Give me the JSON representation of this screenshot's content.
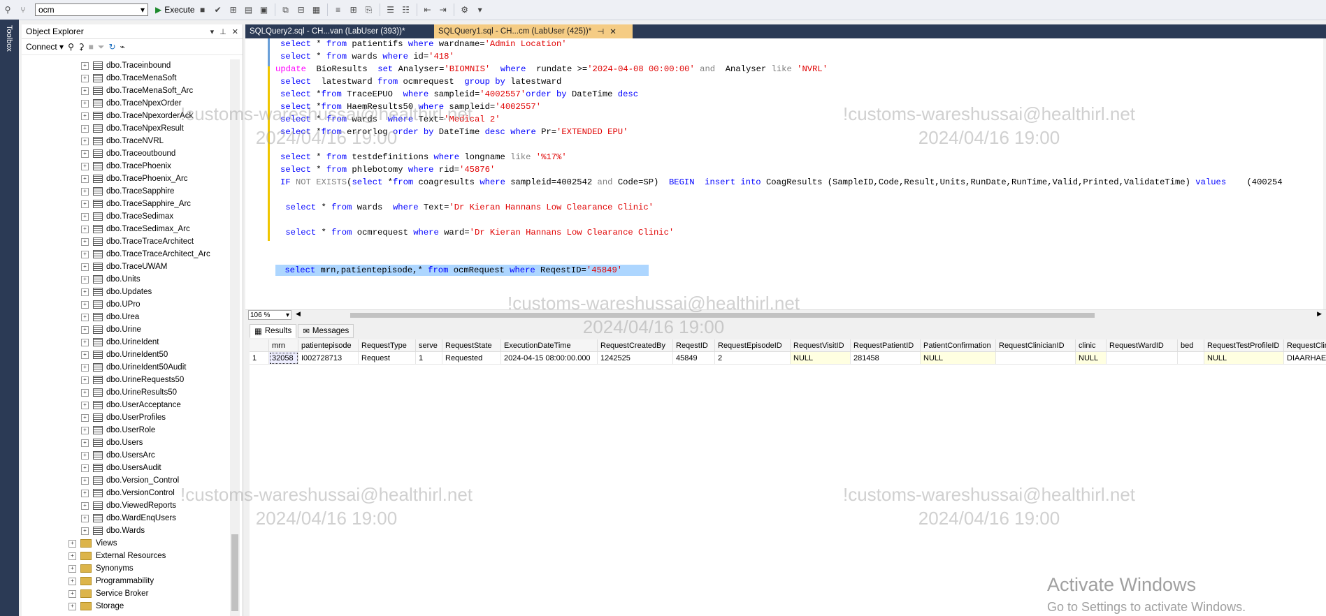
{
  "toolbar": {
    "database": "ocm",
    "execute_label": "Execute"
  },
  "toolbox": {
    "label": "Toolbox"
  },
  "object_explorer": {
    "title": "Object Explorer",
    "connect_label": "Connect",
    "tables": [
      "dbo.Traceinbound",
      "dbo.TraceMenaSoft",
      "dbo.TraceMenaSoft_Arc",
      "dbo.TraceNpexOrder",
      "dbo.TraceNpexorderAck",
      "dbo.TraceNpexResult",
      "dbo.TraceNVRL",
      "dbo.Traceoutbound",
      "dbo.TracePhoenix",
      "dbo.TracePhoenix_Arc",
      "dbo.TraceSapphire",
      "dbo.TraceSapphire_Arc",
      "dbo.TraceSedimax",
      "dbo.TraceSedimax_Arc",
      "dbo.TraceTraceArchitect",
      "dbo.TraceTraceArchitect_Arc",
      "dbo.TraceUWAM",
      "dbo.Units",
      "dbo.Updates",
      "dbo.UPro",
      "dbo.Urea",
      "dbo.Urine",
      "dbo.UrineIdent",
      "dbo.UrineIdent50",
      "dbo.UrineIdent50Audit",
      "dbo.UrineRequests50",
      "dbo.UrineResults50",
      "dbo.UserAcceptance",
      "dbo.UserProfiles",
      "dbo.UserRole",
      "dbo.Users",
      "dbo.UsersArc",
      "dbo.UsersAudit",
      "dbo.Version_Control",
      "dbo.VersionControl",
      "dbo.ViewedReports",
      "dbo.WardEnqUsers",
      "dbo.Wards"
    ],
    "folders": [
      "Views",
      "External Resources",
      "Synonyms",
      "Programmability",
      "Service Broker",
      "Storage"
    ]
  },
  "tabs": [
    {
      "label": "SQLQuery2.sql - CH...van (LabUser (393))*"
    },
    {
      "label": "SQLQuery1.sql - CH...cm (LabUser (425))*"
    }
  ],
  "editor": {
    "zoom": "106 %",
    "lines": [
      [
        [
          "select",
          "kw"
        ],
        [
          " * ",
          ""
        ],
        [
          "from",
          "kw"
        ],
        [
          " patientifs ",
          ""
        ],
        [
          "where",
          "kw"
        ],
        [
          " wardname=",
          ""
        ],
        [
          "'Admin Location'",
          "str"
        ]
      ],
      [
        [
          "select",
          "kw"
        ],
        [
          " * ",
          ""
        ],
        [
          "from",
          "kw"
        ],
        [
          " wards ",
          ""
        ],
        [
          "where",
          "kw"
        ],
        [
          " id=",
          ""
        ],
        [
          "'418'",
          "str"
        ]
      ],
      [
        [
          "update",
          "pink"
        ],
        [
          "  BioResults  ",
          ""
        ],
        [
          "set",
          "kw"
        ],
        [
          " Analyser=",
          ""
        ],
        [
          "'BIOMNIS'",
          "str"
        ],
        [
          "  ",
          ""
        ],
        [
          "where",
          "kw"
        ],
        [
          "  rundate >=",
          ""
        ],
        [
          "'2024-04-08 00:00:00'",
          "str"
        ],
        [
          " ",
          ""
        ],
        [
          "and",
          "gray"
        ],
        [
          "  Analyser ",
          ""
        ],
        [
          "like",
          "gray"
        ],
        [
          " ",
          ""
        ],
        [
          "'NVRL'",
          "str"
        ]
      ],
      [
        [
          "select",
          "kw"
        ],
        [
          "  latestward ",
          ""
        ],
        [
          "from",
          "kw"
        ],
        [
          " ocmrequest  ",
          ""
        ],
        [
          "group by",
          "kw"
        ],
        [
          " latestward",
          ""
        ]
      ],
      [
        [
          "select",
          "kw"
        ],
        [
          " *",
          ""
        ],
        [
          "from",
          "kw"
        ],
        [
          " TraceEPUO  ",
          ""
        ],
        [
          "where",
          "kw"
        ],
        [
          " sampleid=",
          ""
        ],
        [
          "'4002557'",
          "str"
        ],
        [
          "order by",
          "kw"
        ],
        [
          " DateTime ",
          ""
        ],
        [
          "desc",
          "kw"
        ]
      ],
      [
        [
          "select",
          "kw"
        ],
        [
          " *",
          ""
        ],
        [
          "from",
          "kw"
        ],
        [
          " HaemResults50 ",
          ""
        ],
        [
          "where",
          "kw"
        ],
        [
          " sampleid=",
          ""
        ],
        [
          "'4002557'",
          "str"
        ]
      ],
      [
        [
          "select",
          "kw"
        ],
        [
          " * ",
          ""
        ],
        [
          "from",
          "kw"
        ],
        [
          " wards  ",
          ""
        ],
        [
          "where",
          "kw"
        ],
        [
          " Text=",
          ""
        ],
        [
          "'Medical 2'",
          "str"
        ]
      ],
      [
        [
          "select",
          "kw"
        ],
        [
          " *",
          ""
        ],
        [
          "from",
          "kw"
        ],
        [
          " errorlog ",
          ""
        ],
        [
          "order by",
          "kw"
        ],
        [
          " DateTime ",
          ""
        ],
        [
          "desc",
          "kw"
        ],
        [
          " ",
          ""
        ],
        [
          "where",
          "kw"
        ],
        [
          " Pr=",
          ""
        ],
        [
          "'EXTENDED EPU'",
          "str"
        ]
      ],
      [
        [
          "",
          ""
        ]
      ],
      [
        [
          "select",
          "kw"
        ],
        [
          " * ",
          ""
        ],
        [
          "from",
          "kw"
        ],
        [
          " testdefinitions ",
          ""
        ],
        [
          "where",
          "kw"
        ],
        [
          " longname ",
          ""
        ],
        [
          "like",
          "gray"
        ],
        [
          " ",
          ""
        ],
        [
          "'%17%'",
          "str"
        ]
      ],
      [
        [
          "select",
          "kw"
        ],
        [
          " * ",
          ""
        ],
        [
          "from",
          "kw"
        ],
        [
          " phlebotomy ",
          ""
        ],
        [
          "where",
          "kw"
        ],
        [
          " rid=",
          ""
        ],
        [
          "'45876'",
          "str"
        ]
      ],
      [
        [
          "IF",
          "kw"
        ],
        [
          " ",
          ""
        ],
        [
          "NOT EXISTS",
          "gray"
        ],
        [
          "(",
          ""
        ],
        [
          "select",
          "kw"
        ],
        [
          " *",
          ""
        ],
        [
          "from",
          "kw"
        ],
        [
          " coagresults ",
          ""
        ],
        [
          "where",
          "kw"
        ],
        [
          " sampleid=4002542 ",
          ""
        ],
        [
          "and",
          "gray"
        ],
        [
          " Code=SP)  ",
          ""
        ],
        [
          "BEGIN",
          "kw"
        ],
        [
          "  ",
          ""
        ],
        [
          "insert into",
          "kw"
        ],
        [
          " CoagResults ",
          ""
        ],
        [
          "(SampleID,Code,Result,Units,RunDate,RunTime,Valid,Printed,ValidateTime) ",
          ""
        ],
        [
          "values",
          "kw"
        ],
        [
          "    (400254",
          ""
        ]
      ],
      [
        [
          "",
          ""
        ]
      ],
      [
        [
          " ",
          ""
        ],
        [
          "select",
          "kw"
        ],
        [
          " * ",
          ""
        ],
        [
          "from",
          "kw"
        ],
        [
          " wards  ",
          ""
        ],
        [
          "where",
          "kw"
        ],
        [
          " Text=",
          ""
        ],
        [
          "'Dr Kieran Hannans Low Clearance Clinic'",
          "str"
        ]
      ],
      [
        [
          "",
          ""
        ]
      ],
      [
        [
          " ",
          ""
        ],
        [
          "select",
          "kw"
        ],
        [
          " * ",
          ""
        ],
        [
          "from",
          "kw"
        ],
        [
          " ocmrequest ",
          ""
        ],
        [
          "where",
          "kw"
        ],
        [
          " ward=",
          ""
        ],
        [
          "'Dr Kieran Hannans Low Clearance Clinic'",
          "str"
        ]
      ],
      [
        [
          "",
          ""
        ]
      ],
      [
        [
          "",
          ""
        ]
      ],
      [
        [
          " ",
          ""
        ],
        [
          "select",
          "kw"
        ],
        [
          " mrn,patientepisode,* ",
          ""
        ],
        [
          "from",
          "kw"
        ],
        [
          " ocmRequest ",
          ""
        ],
        [
          "where",
          "kw"
        ],
        [
          " ReqestID=",
          ""
        ],
        [
          "'45849'",
          "str"
        ]
      ]
    ]
  },
  "results": {
    "tab_results": "Results",
    "tab_messages": "Messages",
    "columns": [
      "",
      "mrn",
      "patientepisode",
      "RequestType",
      "serve",
      "RequestState",
      "ExecutionDateTime",
      "RequestCreatedBy",
      "ReqestID",
      "RequestEpisodeID",
      "RequestVisitID",
      "RequestPatientID",
      "PatientConfirmation",
      "RequestClinicianID",
      "clinic",
      "RequestWardID",
      "bed",
      "RequestTestProfileID",
      "RequestClinical"
    ],
    "row": [
      "1",
      "32058",
      "I002728713",
      "Request",
      "1",
      "Requested",
      "2024-04-15 08:00:00.000",
      "1242525",
      "45849",
      "2",
      "NULL",
      "281458",
      "NULL",
      "",
      "NULL",
      "",
      "",
      "NULL",
      "DIAARHAE"
    ]
  },
  "watermark": {
    "line1": "!customs-wareshussai@healthirl.net",
    "line2": "2024/04/16 19:00"
  },
  "activate": {
    "title": "Activate Windows",
    "subtitle": "Go to Settings to activate Windows."
  }
}
